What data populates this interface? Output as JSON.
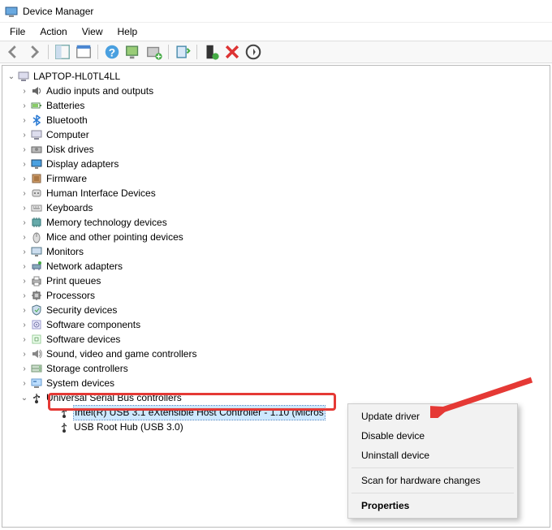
{
  "window": {
    "title": "Device Manager"
  },
  "menubar": {
    "file": "File",
    "action": "Action",
    "view": "View",
    "help": "Help"
  },
  "tree": {
    "root": "LAPTOP-HL0TL4LL",
    "categories": [
      {
        "label": "Audio inputs and outputs",
        "icon": "speaker-icon"
      },
      {
        "label": "Batteries",
        "icon": "battery-icon"
      },
      {
        "label": "Bluetooth",
        "icon": "bluetooth-icon"
      },
      {
        "label": "Computer",
        "icon": "computer-icon"
      },
      {
        "label": "Disk drives",
        "icon": "disk-icon"
      },
      {
        "label": "Display adapters",
        "icon": "display-icon"
      },
      {
        "label": "Firmware",
        "icon": "firmware-icon"
      },
      {
        "label": "Human Interface Devices",
        "icon": "hid-icon"
      },
      {
        "label": "Keyboards",
        "icon": "keyboard-icon"
      },
      {
        "label": "Memory technology devices",
        "icon": "memory-icon"
      },
      {
        "label": "Mice and other pointing devices",
        "icon": "mouse-icon"
      },
      {
        "label": "Monitors",
        "icon": "monitor-icon"
      },
      {
        "label": "Network adapters",
        "icon": "network-icon"
      },
      {
        "label": "Print queues",
        "icon": "printer-icon"
      },
      {
        "label": "Processors",
        "icon": "cpu-icon"
      },
      {
        "label": "Security devices",
        "icon": "security-icon"
      },
      {
        "label": "Software components",
        "icon": "software-icon"
      },
      {
        "label": "Software devices",
        "icon": "software-device-icon"
      },
      {
        "label": "Sound, video and game controllers",
        "icon": "sound-icon"
      },
      {
        "label": "Storage controllers",
        "icon": "storage-icon"
      },
      {
        "label": "System devices",
        "icon": "system-icon"
      }
    ],
    "usb_category": "Universal Serial Bus controllers",
    "usb_children": [
      "Intel(R) USB 3.1 eXtensible Host Controller - 1.10 (Micros",
      "USB Root Hub (USB 3.0)"
    ]
  },
  "context_menu": {
    "update": "Update driver",
    "disable": "Disable device",
    "uninstall": "Uninstall device",
    "scan": "Scan for hardware changes",
    "properties": "Properties"
  }
}
